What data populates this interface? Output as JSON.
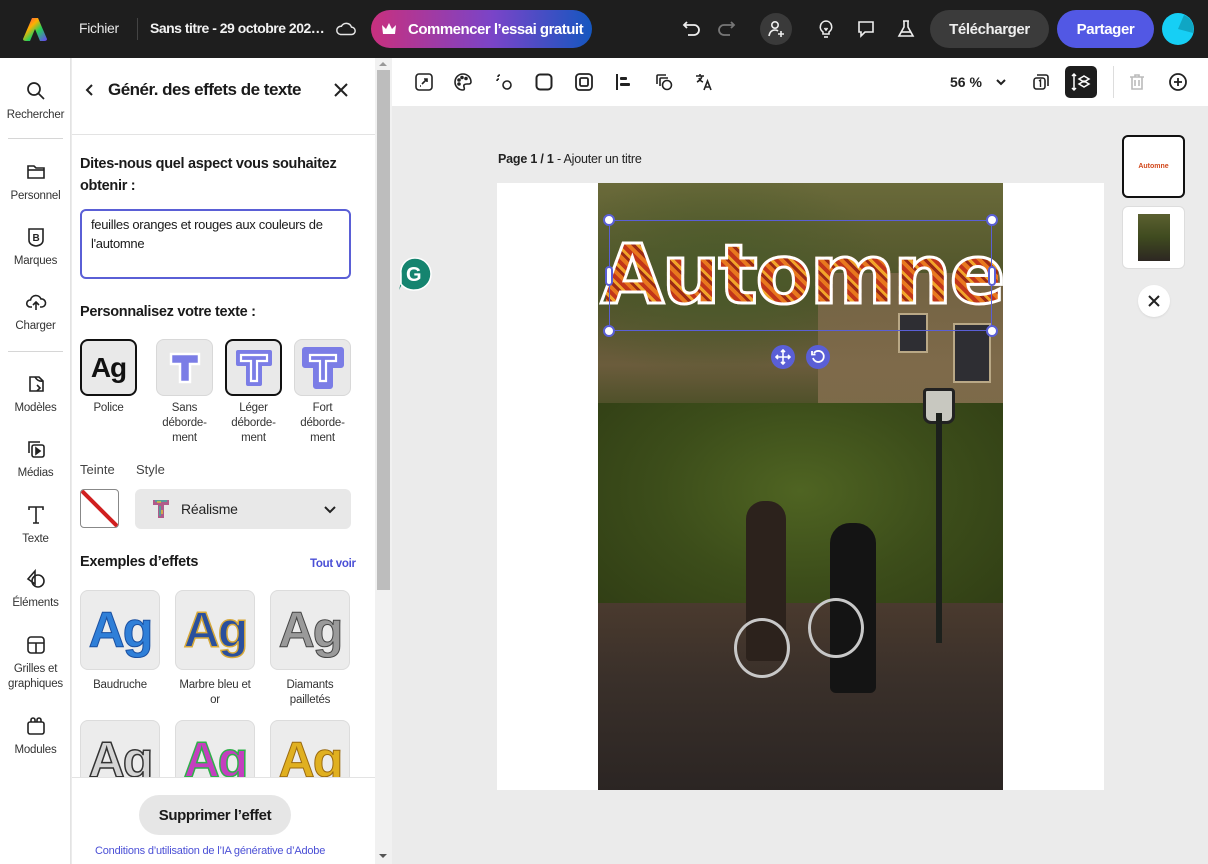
{
  "topbar": {
    "menu_label": "Fichier",
    "document_title": "Sans titre - 29 octobre 202…",
    "trial_button": "Commencer l’essai gratuit",
    "download_button": "Télécharger",
    "share_button": "Partager",
    "icons": [
      "adobe-express-logo",
      "cloud-icon",
      "crown-icon",
      "undo-icon",
      "redo-icon",
      "invite-user-icon",
      "lightbulb-icon",
      "comment-icon",
      "flask-icon",
      "avatar"
    ]
  },
  "rail": {
    "items": [
      {
        "label": "Rechercher",
        "icon": "search-icon"
      },
      {
        "label": "Personnel",
        "icon": "folder-icon"
      },
      {
        "label": "Marques",
        "icon": "brand-icon"
      },
      {
        "label": "Charger",
        "icon": "upload-cloud-icon"
      },
      {
        "label": "Modèles",
        "icon": "templates-icon"
      },
      {
        "label": "Médias",
        "icon": "media-icon"
      },
      {
        "label": "Texte",
        "icon": "text-icon"
      },
      {
        "label": "Éléments",
        "icon": "shapes-icon"
      },
      {
        "label": "Grilles et graphiques",
        "icon": "grid-icon"
      },
      {
        "label": "Modules",
        "icon": "addons-icon"
      }
    ]
  },
  "panel": {
    "title": "Génér. des effets de texte",
    "prompt_label": "Dites-nous quel aspect vous souhaitez obtenir :",
    "prompt_value": "feuilles oranges et rouges aux couleurs de l'automne",
    "customize_label": "Personnalisez votre texte :",
    "shape_options": [
      {
        "label": "Police",
        "selected": true
      },
      {
        "label": "Sans déborde-ment",
        "selected": false
      },
      {
        "label": "Léger déborde-ment",
        "selected": true
      },
      {
        "label": "Fort déborde-ment",
        "selected": false
      }
    ],
    "tint_label": "Teinte",
    "style_label": "Style",
    "style_value": "Réalisme",
    "examples_title": "Exemples d’effets",
    "see_all": "Tout voir",
    "examples": [
      {
        "label": "Baudruche",
        "glyph": "Ag",
        "color": "#2f7fd8"
      },
      {
        "label": "Marbre bleu et or",
        "glyph": "Ag",
        "color": "#2a4f9c"
      },
      {
        "label": "Diamants pailletés",
        "glyph": "Ag",
        "color": "#8a8a8a"
      },
      {
        "label": "",
        "glyph": "Ag",
        "color": "#555555"
      },
      {
        "label": "",
        "glyph": "Ag",
        "color": "#c43fbf"
      },
      {
        "label": "",
        "glyph": "Ag",
        "color": "#d9a520"
      }
    ],
    "remove_button": "Supprimer l’effet",
    "terms_link": "Conditions d’utilisation de l’IA générative d’Adobe"
  },
  "canvas_toolbar": {
    "zoom_value": "56 %",
    "icons": [
      "resize-icon",
      "palette-icon",
      "animate-icon",
      "shape-icon",
      "frame-icon",
      "align-icon",
      "duplicate-icon",
      "translate-icon",
      "pages-icon",
      "layers-icon",
      "delete-icon",
      "add-icon"
    ]
  },
  "canvas": {
    "page_label_bold": "Page 1 / 1",
    "page_label_rest": " - Ajouter un titre",
    "text_effect": "Automne",
    "thumbnail_text": "Automne"
  },
  "colors": {
    "accent": "#5258e4",
    "selection": "#5a5fd6",
    "topbar_bg": "#1e1e1e",
    "effect_orange": "#d2481c"
  }
}
